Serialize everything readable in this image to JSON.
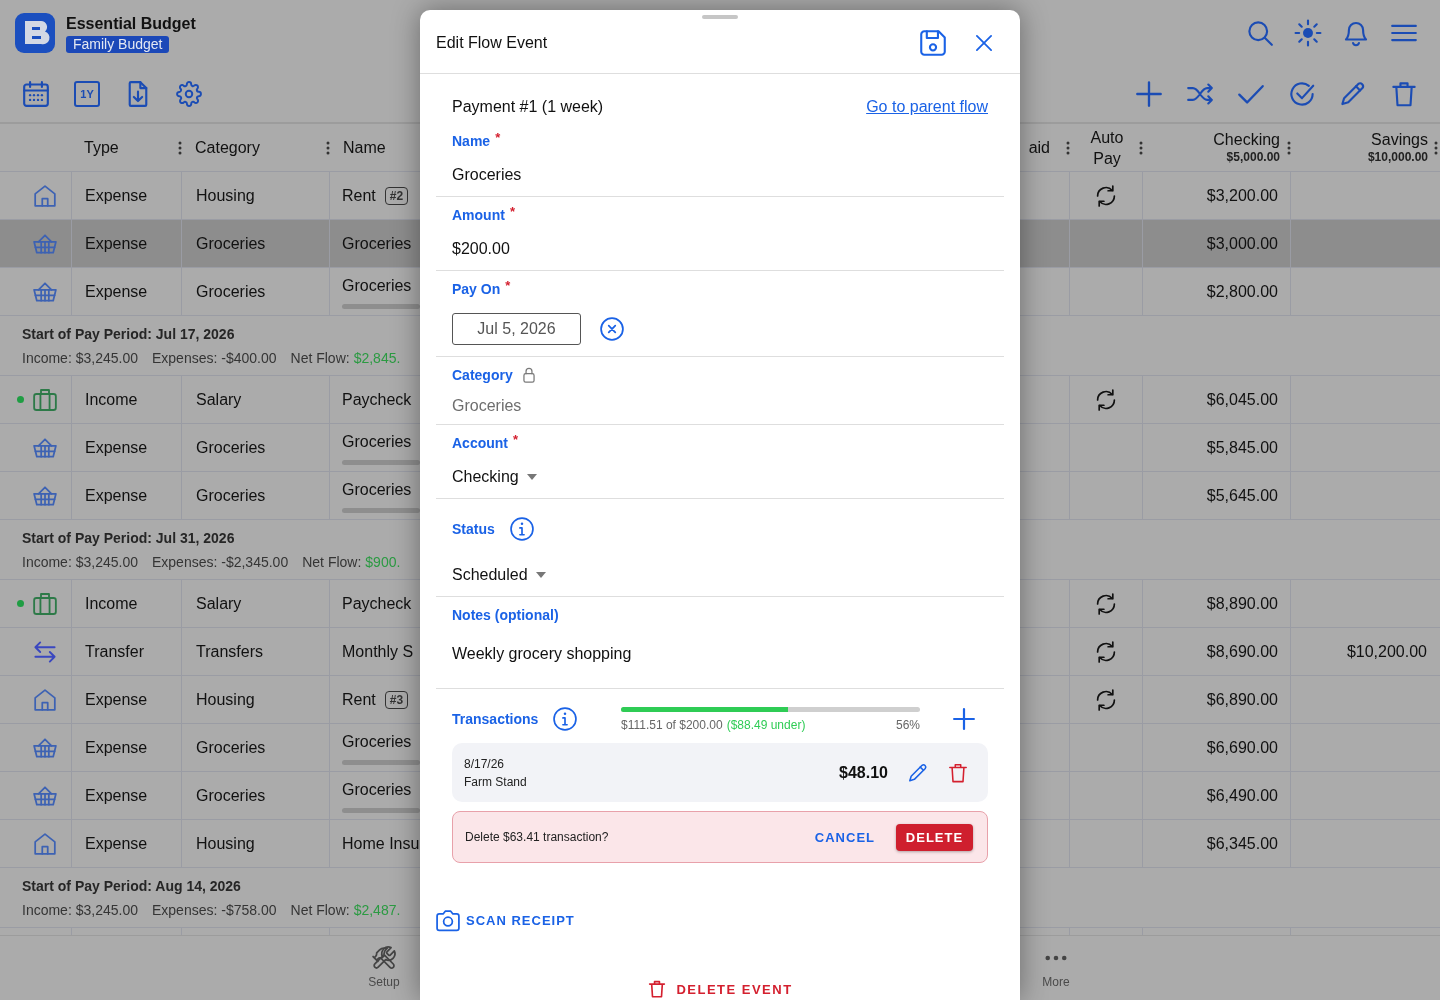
{
  "header": {
    "title": "Essential Budget",
    "budget": "Family Budget",
    "actions": [
      {
        "kind": "search"
      },
      {
        "kind": "brightness"
      },
      {
        "kind": "notifications"
      },
      {
        "kind": "menu"
      }
    ]
  },
  "toolbar": {
    "left": [
      {
        "kind": "calendar"
      },
      {
        "kind": "year",
        "label": "1Y"
      },
      {
        "kind": "export"
      },
      {
        "kind": "settings"
      }
    ],
    "right": [
      {
        "kind": "add"
      },
      {
        "kind": "shuffle"
      },
      {
        "kind": "check"
      },
      {
        "kind": "check-circle"
      },
      {
        "kind": "edit"
      },
      {
        "kind": "delete"
      }
    ]
  },
  "table": {
    "columns": [
      {
        "label": "Type",
        "menu": true
      },
      {
        "label": "Category",
        "menu": true
      },
      {
        "label": "Name",
        "menu": false
      },
      {
        "label": "aid",
        "menu": true
      },
      {
        "label": "Auto Pay",
        "menu": true
      },
      {
        "label": "Checking",
        "total": "$5,000.00",
        "menu": true
      },
      {
        "label": "Savings",
        "total": "$10,000.00",
        "menu": true
      }
    ],
    "sections": [
      {
        "rows": [
          {
            "kind": "housing",
            "status_dot": false,
            "type": "Expense",
            "category": "Housing",
            "name": "Rent",
            "badge": "#2",
            "bar": false,
            "auto_pay": true,
            "checking": "$3,200.00",
            "selected": false
          },
          {
            "kind": "groceries",
            "status_dot": false,
            "type": "Expense",
            "category": "Groceries",
            "name": "Groceries",
            "bar": false,
            "auto_pay": false,
            "checking": "$3,000.00",
            "selected": true
          },
          {
            "kind": "groceries",
            "status_dot": false,
            "type": "Expense",
            "category": "Groceries",
            "name": "Groceries",
            "bar": true,
            "auto_pay": false,
            "checking": "$2,800.00",
            "selected": false
          }
        ]
      },
      {
        "period": {
          "title": "Start of Pay Period: Jul 17, 2026",
          "income": "Income: $3,245.00",
          "expenses": "Expenses: -$400.00",
          "net_flow_label": "Net Flow:",
          "net_flow": "$2,845."
        },
        "rows": [
          {
            "kind": "salary",
            "status_dot": true,
            "type": "Income",
            "category": "Salary",
            "name": "Paycheck",
            "bar": false,
            "auto_pay": true,
            "checking": "$6,045.00",
            "selected": false
          },
          {
            "kind": "groceries",
            "status_dot": false,
            "type": "Expense",
            "category": "Groceries",
            "name": "Groceries",
            "bar": true,
            "auto_pay": false,
            "checking": "$5,845.00",
            "selected": false
          },
          {
            "kind": "groceries",
            "status_dot": false,
            "type": "Expense",
            "category": "Groceries",
            "name": "Groceries",
            "bar": true,
            "auto_pay": false,
            "checking": "$5,645.00",
            "selected": false
          }
        ]
      },
      {
        "period": {
          "title": "Start of Pay Period: Jul 31, 2026",
          "income": "Income: $3,245.00",
          "expenses": "Expenses: -$2,345.00",
          "net_flow_label": "Net Flow:",
          "net_flow": "$900."
        },
        "rows": [
          {
            "kind": "salary",
            "status_dot": true,
            "type": "Income",
            "category": "Salary",
            "name": "Paycheck",
            "bar": false,
            "auto_pay": true,
            "checking": "$8,890.00",
            "selected": false
          },
          {
            "kind": "transfer",
            "status_dot": false,
            "type": "Transfer",
            "category": "Transfers",
            "name": "Monthly S",
            "bar": false,
            "auto_pay": true,
            "checking": "$8,690.00",
            "savings": "$10,200.00",
            "selected": false
          },
          {
            "kind": "housing",
            "status_dot": false,
            "type": "Expense",
            "category": "Housing",
            "name": "Rent",
            "badge": "#3",
            "bar": false,
            "auto_pay": true,
            "checking": "$6,890.00",
            "selected": false
          },
          {
            "kind": "groceries",
            "status_dot": false,
            "type": "Expense",
            "category": "Groceries",
            "name": "Groceries",
            "bar": true,
            "auto_pay": false,
            "checking": "$6,690.00",
            "selected": false
          },
          {
            "kind": "groceries",
            "status_dot": false,
            "type": "Expense",
            "category": "Groceries",
            "name": "Groceries",
            "bar": true,
            "auto_pay": false,
            "checking": "$6,490.00",
            "selected": false
          },
          {
            "kind": "housing",
            "status_dot": false,
            "type": "Expense",
            "category": "Housing",
            "name": "Home Insu",
            "bar": false,
            "auto_pay": false,
            "checking": "$6,345.00",
            "selected": false
          }
        ]
      },
      {
        "period": {
          "title": "Start of Pay Period: Aug 14, 2026",
          "income": "Income: $3,245.00",
          "expenses": "Expenses: -$758.00",
          "net_flow_label": "Net Flow:",
          "net_flow": "$2,487."
        }
      }
    ]
  },
  "tab_bar": [
    {
      "kind": "setup",
      "label": "Setup"
    },
    {
      "kind": "more",
      "label": "More"
    }
  ],
  "dialog": {
    "title": "Edit Flow Event",
    "subtitle": "Payment #1 (1 week)",
    "parent_link": "Go to parent flow",
    "required_mark": "*",
    "fields": [
      {
        "kind": "text",
        "label": "Name",
        "required": true,
        "locked": false,
        "info": false,
        "value": "Groceries"
      },
      {
        "kind": "text",
        "label": "Amount",
        "required": true,
        "locked": false,
        "info": false,
        "value": "$200.00"
      },
      {
        "kind": "date",
        "label": "Pay On",
        "required": true,
        "locked": false,
        "info": false,
        "value": "Jul 5, 2026"
      },
      {
        "kind": "text",
        "label": "Category",
        "required": false,
        "locked": true,
        "info": false,
        "value": "Groceries"
      },
      {
        "kind": "select",
        "label": "Account",
        "required": true,
        "locked": false,
        "info": false,
        "value": "Checking"
      },
      {
        "kind": "select",
        "label": "Status",
        "required": false,
        "locked": false,
        "info": true,
        "value": "Scheduled"
      },
      {
        "kind": "textarea",
        "label": "Notes (optional)",
        "required": false,
        "locked": false,
        "info": false,
        "value": "Weekly grocery shopping"
      }
    ],
    "transactions": {
      "label": "Transactions",
      "info": true,
      "level": 0.56,
      "spent": "$111.51 of $200.00",
      "remaining": "($88.49 under)",
      "percent": "56%",
      "items": [
        {
          "date": "8/17/26",
          "payee": "Farm Stand",
          "amount": "$48.10"
        }
      ],
      "confirm": {
        "message": "Delete $63.41 transaction?",
        "cancel": "CANCEL",
        "delete": "DELETE"
      }
    },
    "scan_receipt": "SCAN RECEIPT",
    "delete_event": "DELETE EVENT"
  }
}
